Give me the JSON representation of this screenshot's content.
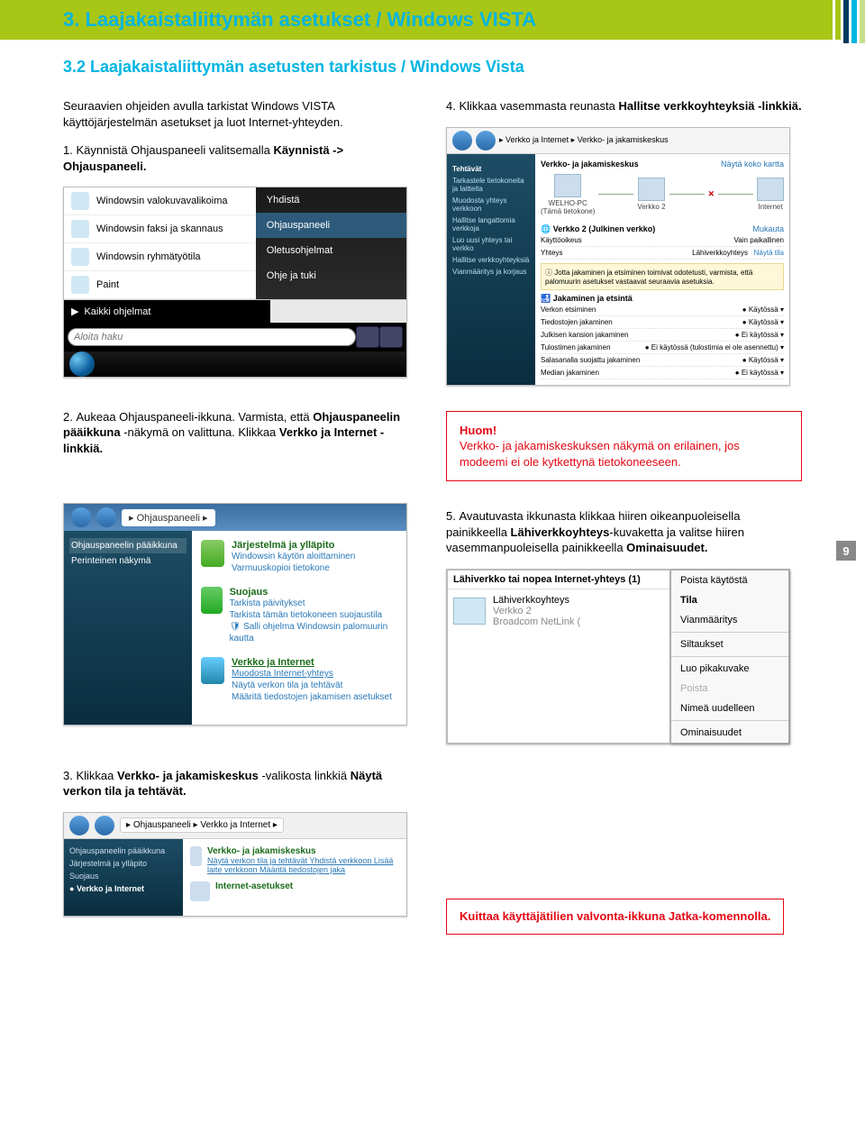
{
  "pageNumber": "9",
  "header": {
    "title": "3. Laajakaistaliittymän asetukset / Windows VISTA"
  },
  "subheading": "3.2 Laajakaistaliittymän asetusten tarkistus / Windows Vista",
  "intro": "Seuraavien ohjeiden avulla tarkistat Windows VISTA käyttöjärjestelmän asetukset ja luot Internet-yhteyden.",
  "step1": {
    "num": "1.",
    "text": "Käynnistä Ohjauspaneeli valitsemalla ",
    "bold": "Käynnistä -> Ohjauspaneeli."
  },
  "step4": {
    "num": "4.",
    "text": "Klikkaa vasemmasta reunasta ",
    "bold": "Hallitse verkkoyhteyksiä -linkkiä."
  },
  "startMenu": {
    "leftItems": [
      "Windowsin valokuvavalikoima",
      "Windowsin faksi ja skannaus",
      "Windowsin ryhmätyötila",
      "Paint"
    ],
    "rightItems": [
      "Yhdistä",
      "Ohjauspaneeli",
      "Oletusohjelmat",
      "Ohje ja tuki"
    ],
    "allPrograms": "Kaikki ohjelmat",
    "searchPlaceholder": "Aloita haku"
  },
  "verkkoShare": {
    "crumb1": "Verkko ja Internet",
    "crumb2": "Verkko- ja jakamiskeskus",
    "sideHdr": "Tehtävät",
    "side": [
      "Tarkastele tietokoneita ja laitteita",
      "Muodosta yhteys verkkoon",
      "Hallitse langattomia verkkoja",
      "Luo uusi yhteys tai verkko",
      "Hallitse verkkoyhteyksiä",
      "Vianmääritys ja korjaus"
    ],
    "mainTitle": "Verkko- ja jakamiskeskus",
    "mapLink": "Näytä koko kartta",
    "node1": "WELHO-PC",
    "node1b": "(Tämä tietokone)",
    "node2": "Verkko 2",
    "node3": "Internet",
    "subhead": "Verkko 2 (Julkinen verkko)",
    "mukautus": "Mukauta",
    "rows": [
      [
        "Käyttöoikeus",
        "Vain paikallinen"
      ],
      [
        "Yhteys",
        "Lähiverkkoyhteys"
      ]
    ],
    "nayta": "Näytä tila",
    "info": "Jotta jakaminen ja etsiminen toimivat odotetusti, varmista, että palomuurin asetukset vastaavat seuraavia asetuksia.",
    "jakHdr": "Jakaminen ja etsintä",
    "jakRows": [
      [
        "Verkon etsiminen",
        "Käytössä"
      ],
      [
        "Tiedostojen jakaminen",
        "Käytössä"
      ],
      [
        "Julkisen kansion jakaminen",
        "Ei käytössä"
      ],
      [
        "Tulostimen jakaminen",
        "Ei käytössä (tulostimia ei ole asennettu)"
      ],
      [
        "Salasanalla suojattu jakaminen",
        "Käytössä"
      ],
      [
        "Median jakaminen",
        "Ei käytössä"
      ]
    ]
  },
  "step2": {
    "num": "2.",
    "text1": "Aukeaa Ohjauspaneeli-ikkuna. Varmista, että ",
    "bold1": "Ohjauspaneelin pääikkuna",
    "text2": " -näkymä on valittuna. Klikkaa ",
    "bold2": "Verkko ja Internet -linkkiä."
  },
  "note1": {
    "hdr": "Huom!",
    "body": "Verkko- ja jakamiskeskuksen näkymä on erilainen, jos modeemi ei ole kytkettynä tietokoneeseen."
  },
  "cpWindow": {
    "crumb": "Ohjauspaneeli",
    "sideTitle": "Ohjauspaneelin pääikkuna",
    "sideSub": "Perinteinen näkymä",
    "cat1": {
      "title": "Järjestelmä ja ylläpito",
      "subs": [
        "Windowsin käytön aloittaminen",
        "Varmuuskopioi tietokone"
      ]
    },
    "cat2": {
      "title": "Suojaus",
      "subs": [
        "Tarkista päivitykset",
        "Tarkista tämän tietokoneen suojaustila",
        "Salli ohjelma Windowsin palomuurin kautta"
      ]
    },
    "cat3": {
      "title": "Verkko ja Internet",
      "subs": [
        "Muodosta Internet-yhteys",
        "Näytä verkon tila ja tehtävät",
        "Määritä tiedostojen jakamisen asetukset"
      ]
    }
  },
  "step5": {
    "num": "5.",
    "text1": "Avautuvasta ikkunasta klikkaa hiiren oikeanpuoleisella painikkeella ",
    "bold1": "Lähiverkkoyhteys",
    "text2": "-kuvaketta ja valitse hiiren vasemmanpuoleisella painikkeella ",
    "bold2": "Ominaisuudet."
  },
  "lahiv": {
    "header": "Lähiverkko tai nopea Internet-yhteys (1)",
    "name": "Lähiverkkoyhteys",
    "net": "Verkko 2",
    "adapter": "Broadcom NetLink (",
    "menu": [
      "Poista käytöstä",
      "Tila",
      "Vianmääritys",
      "—",
      "Siltaukset",
      "—",
      "Luo pikakuvake",
      "Poista",
      "Nimeä uudelleen",
      "—",
      "Ominaisuudet"
    ]
  },
  "step3": {
    "num": "3.",
    "text1": "Klikkaa ",
    "bold1": "Verkko- ja jakamiskeskus",
    "text2": " -valikosta linkkiä ",
    "bold2": "Näytä verkon tila ja tehtävät."
  },
  "viWindow": {
    "crumb1": "Ohjauspaneeli",
    "crumb2": "Verkko ja Internet",
    "side": [
      "Ohjauspaneelin pääikkuna",
      "Järjestelmä ja ylläpito",
      "Suojaus",
      "Verkko ja Internet"
    ],
    "cat1": {
      "title": "Verkko- ja jakamiskeskus",
      "subs": "Näytä verkon tila ja tehtävät   Yhdistä verkkoon   Lisää laite verkkoon   Määritä tiedostojen jaka"
    },
    "cat2": {
      "title": "Internet-asetukset"
    }
  },
  "note2": "Kuittaa käyttäjätilien valvonta-ikkuna Jatka-komennolla."
}
